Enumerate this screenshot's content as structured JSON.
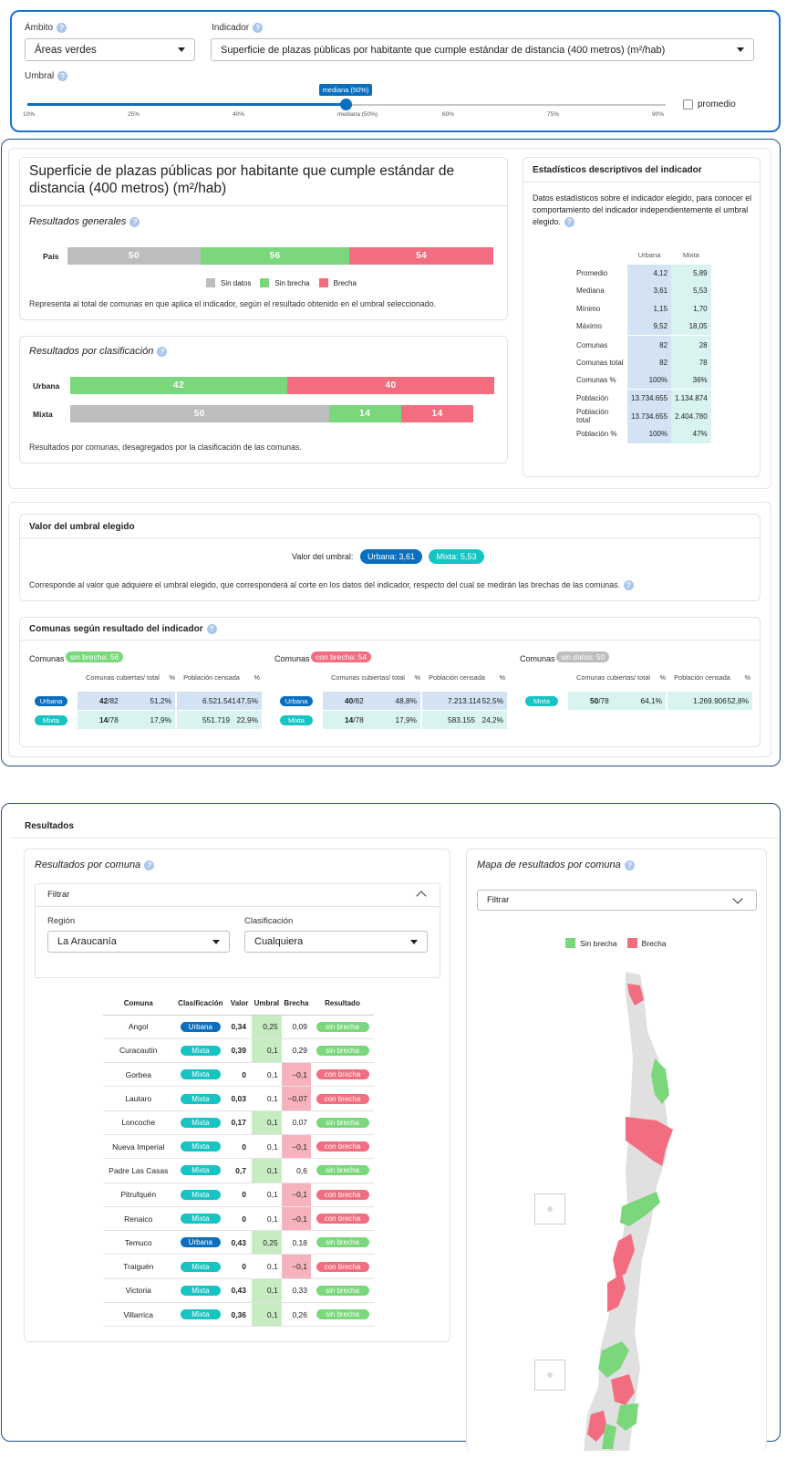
{
  "controls": {
    "ambito_label": "Ámbito",
    "ambito_value": "Áreas verdes",
    "indicador_label": "Indicador",
    "indicador_value": "Superficie de plazas públicas por habitante que cumple estándar de distancia (400 metros) (m²/hab)",
    "umbral_label": "Umbral",
    "slider_tooltip": "mediana (50%)",
    "slider_value_percent": 50,
    "ticks": [
      "10%",
      "25%",
      "40%",
      "mediana (50%)",
      "60%",
      "75%",
      "90%"
    ],
    "promedio_label": "promedio"
  },
  "indicator": {
    "title": "Superficie de plazas públicas por habitante que cumple estándar de distancia (400 metros) (m²/hab)"
  },
  "general": {
    "heading": "Resultados generales",
    "row_label": "País",
    "values": [
      50,
      56,
      54
    ],
    "legend": [
      "Sin datos",
      "Sin brecha",
      "Brecha"
    ],
    "note": "Representa al total de comunas en que aplica el indicador, según el resultado obtenido en el umbral seleccionado."
  },
  "clasif": {
    "heading": "Resultados por clasificación",
    "rows": [
      {
        "label": "Urbana",
        "segments": [
          {
            "v": "42",
            "c": "green",
            "n": 42
          },
          {
            "v": "40",
            "c": "red",
            "n": 40
          }
        ]
      },
      {
        "label": "Mixta",
        "segments": [
          {
            "v": "50",
            "c": "gray",
            "n": 50
          },
          {
            "v": "14",
            "c": "green",
            "n": 14
          },
          {
            "v": "14",
            "c": "red",
            "n": 14
          }
        ]
      }
    ],
    "note": "Resultados por comunas, desagregados por la clasificación de las comunas."
  },
  "stats": {
    "heading": "Estadísticos descriptivos del indicador",
    "desc": "Datos estadísticos sobre el indicador elegido, para conocer el comportamiento del indicador independientemente el umbral elegido.",
    "col_u": "Urbana",
    "col_m": "Mixta",
    "rows": [
      [
        "Promedio",
        "4,12",
        "5,89"
      ],
      [
        "Mediana",
        "3,61",
        "5,53"
      ],
      [
        "Mínimo",
        "1,15",
        "1,70"
      ],
      [
        "Máximo",
        "9,52",
        "18,05"
      ],
      [
        "Comunas",
        "82",
        "28"
      ],
      [
        "Comunas total",
        "82",
        "78"
      ],
      [
        "Comunas %",
        "100%",
        "36%"
      ],
      [
        "Población",
        "13.734.655",
        "1.134.874"
      ],
      [
        "Población total",
        "13.734.655",
        "2.404.780"
      ],
      [
        "Población %",
        "100%",
        "47%"
      ]
    ]
  },
  "umbral": {
    "heading": "Valor del umbral elegido",
    "label": "Valor del umbral:",
    "urbana": "Urbana: 3,61",
    "mixta": "Mixta: 5,53",
    "note": "Corresponde al valor que adquiere el umbral elegido, que corresponderá al corte en los datos del indicador, respecto del cual se medirán las brechas de las comunas."
  },
  "comunas": {
    "heading": "Comunas según resultado del indicador",
    "groups": [
      {
        "prefix": "Comunas",
        "badge": "sin brecha: 56",
        "color": "green",
        "h1": "Comunas cubiertas/ total",
        "h2": "%",
        "h3": "Población censada",
        "h4": "%",
        "rows": [
          {
            "tag": "Urbana",
            "tc": "blue",
            "a": "42",
            "b": "/82",
            "p": "51,2%",
            "pop": "6.521.541",
            "pp": "47,5%"
          },
          {
            "tag": "Mixta",
            "tc": "teal",
            "a": "14",
            "b": "/78",
            "p": "17,9%",
            "pop": "551.719",
            "pp": "22,9%"
          }
        ]
      },
      {
        "prefix": "Comunas",
        "badge": "con brecha: 54",
        "color": "red",
        "h1": "Comunas cubiertas/ total",
        "h2": "%",
        "h3": "Población censada",
        "h4": "%",
        "rows": [
          {
            "tag": "Urbana",
            "tc": "blue",
            "a": "40",
            "b": "/82",
            "p": "48,8%",
            "pop": "7.213.114",
            "pp": "52,5%"
          },
          {
            "tag": "Mixta",
            "tc": "teal",
            "a": "14",
            "b": "/78",
            "p": "17,9%",
            "pop": "583.155",
            "pp": "24,2%"
          }
        ]
      },
      {
        "prefix": "Comunas",
        "badge": "sin datos: 50",
        "color": "gray",
        "h1": "Comunas cubiertas/ total",
        "h2": "%",
        "h3": "Población censada",
        "h4": "%",
        "rows": [
          {
            "tag": "Mixta",
            "tc": "teal",
            "a": "50",
            "b": "/78",
            "p": "64,1%",
            "pop": "1.269.906",
            "pp": "52,8%"
          }
        ]
      }
    ]
  },
  "resultados": {
    "heading": "Resultados",
    "por_comuna": "Resultados por comuna",
    "filtrar": "Filtrar",
    "region_label": "Región",
    "region_value": "La Araucanía",
    "clasif_label": "Clasificación",
    "clasif_value": "Cualquiera",
    "cols": [
      "Comuna",
      "Clasificación",
      "Valor",
      "Umbral",
      "Brecha",
      "Resultado"
    ],
    "rows": [
      [
        "Angol",
        "Urbana",
        "0,34",
        "0,25",
        "0,09",
        "sin brecha"
      ],
      [
        "Curacautín",
        "Mixta",
        "0,39",
        "0,1",
        "0,29",
        "sin brecha"
      ],
      [
        "Gorbea",
        "Mixta",
        "0",
        "0,1",
        "−0,1",
        "con brecha"
      ],
      [
        "Lautaro",
        "Mixta",
        "0,03",
        "0,1",
        "−0,07",
        "con brecha"
      ],
      [
        "Loncoche",
        "Mixta",
        "0,17",
        "0,1",
        "0,07",
        "sin brecha"
      ],
      [
        "Nueva Imperial",
        "Mixta",
        "0",
        "0,1",
        "−0,1",
        "con brecha"
      ],
      [
        "Padre Las Casas",
        "Mixta",
        "0,7",
        "0,1",
        "0,6",
        "sin brecha"
      ],
      [
        "Pitrufquén",
        "Mixta",
        "0",
        "0,1",
        "−0,1",
        "con brecha"
      ],
      [
        "Renaico",
        "Mixta",
        "0",
        "0,1",
        "−0,1",
        "con brecha"
      ],
      [
        "Temuco",
        "Urbana",
        "0,43",
        "0,25",
        "0,18",
        "sin brecha"
      ],
      [
        "Traiguén",
        "Mixta",
        "0",
        "0,1",
        "−0,1",
        "con brecha"
      ],
      [
        "Victoria",
        "Mixta",
        "0,43",
        "0,1",
        "0,33",
        "sin brecha"
      ],
      [
        "Villarrica",
        "Mixta",
        "0,36",
        "0,1",
        "0,26",
        "sin brecha"
      ]
    ]
  },
  "mapa": {
    "heading": "Mapa de resultados por comuna",
    "filtrar": "Filtrar",
    "legend_sin": "Sin brecha",
    "legend_con": "Brecha"
  },
  "colors": {
    "green": "#7bd77b",
    "red": "#f26d80",
    "gray": "#bdbdbd",
    "blue": "#0b6fbf",
    "teal": "#17c3c3",
    "border": "#1f4e8c"
  }
}
